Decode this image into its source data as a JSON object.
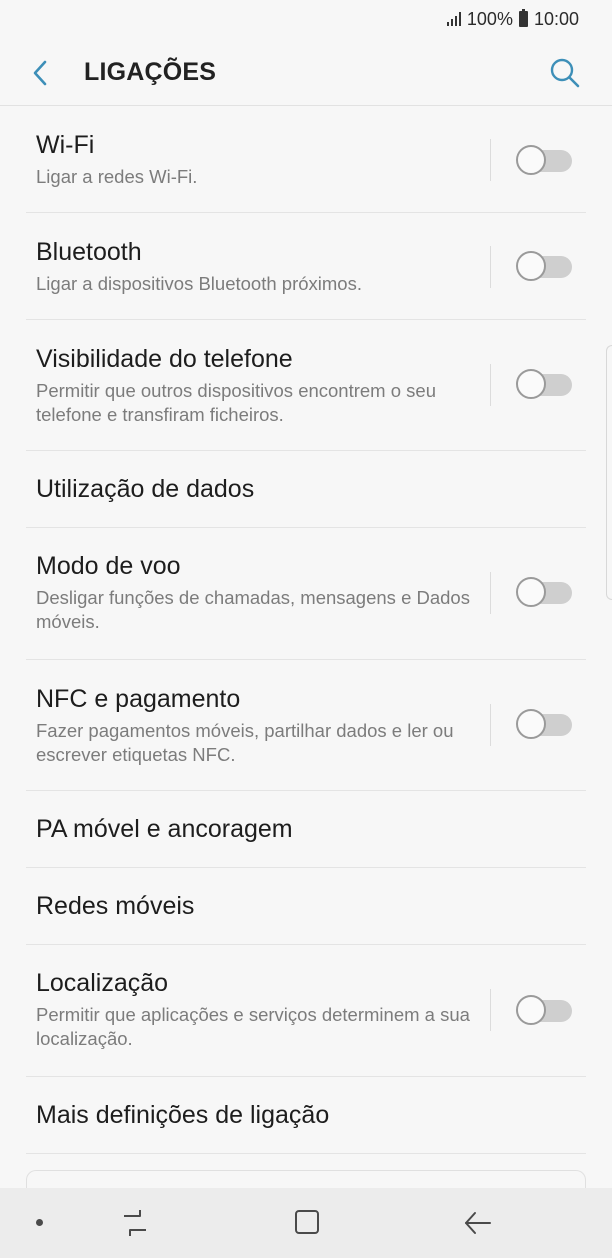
{
  "status_bar": {
    "battery": "100%",
    "time": "10:00"
  },
  "header": {
    "title": "LIGAÇÕES"
  },
  "items": [
    {
      "title": "Wi-Fi",
      "subtitle": "Ligar a redes Wi-Fi.",
      "toggle": "off"
    },
    {
      "title": "Bluetooth",
      "subtitle": "Ligar a dispositivos Bluetooth próximos.",
      "toggle": "off"
    },
    {
      "title": "Visibilidade do telefone",
      "subtitle": "Permitir que outros dispositivos encontrem o seu telefone e transfiram ficheiros.",
      "toggle": "off"
    },
    {
      "title": "Utilização de dados"
    },
    {
      "title": "Modo de voo",
      "subtitle": "Desligar funções de chamadas, mensagens e Dados móveis.",
      "toggle": "off"
    },
    {
      "title": "NFC e pagamento",
      "subtitle": "Fazer pagamentos móveis, partilhar dados e ler ou escrever etiquetas NFC.",
      "toggle": "off"
    },
    {
      "title": "PA móvel e ancoragem"
    },
    {
      "title": "Redes móveis"
    },
    {
      "title": "Localização",
      "subtitle": "Permitir que aplicações e serviços determinem a sua localização.",
      "toggle": "off"
    },
    {
      "title": "Mais definições de ligação"
    }
  ],
  "colors": {
    "accent": "#3d8fb8",
    "background": "#f7f7f7"
  },
  "icons": {
    "back": "chevron-left-icon",
    "search": "search-icon",
    "recents": "recents-icon",
    "home": "home-icon",
    "nav_back": "back-arrow-icon"
  }
}
